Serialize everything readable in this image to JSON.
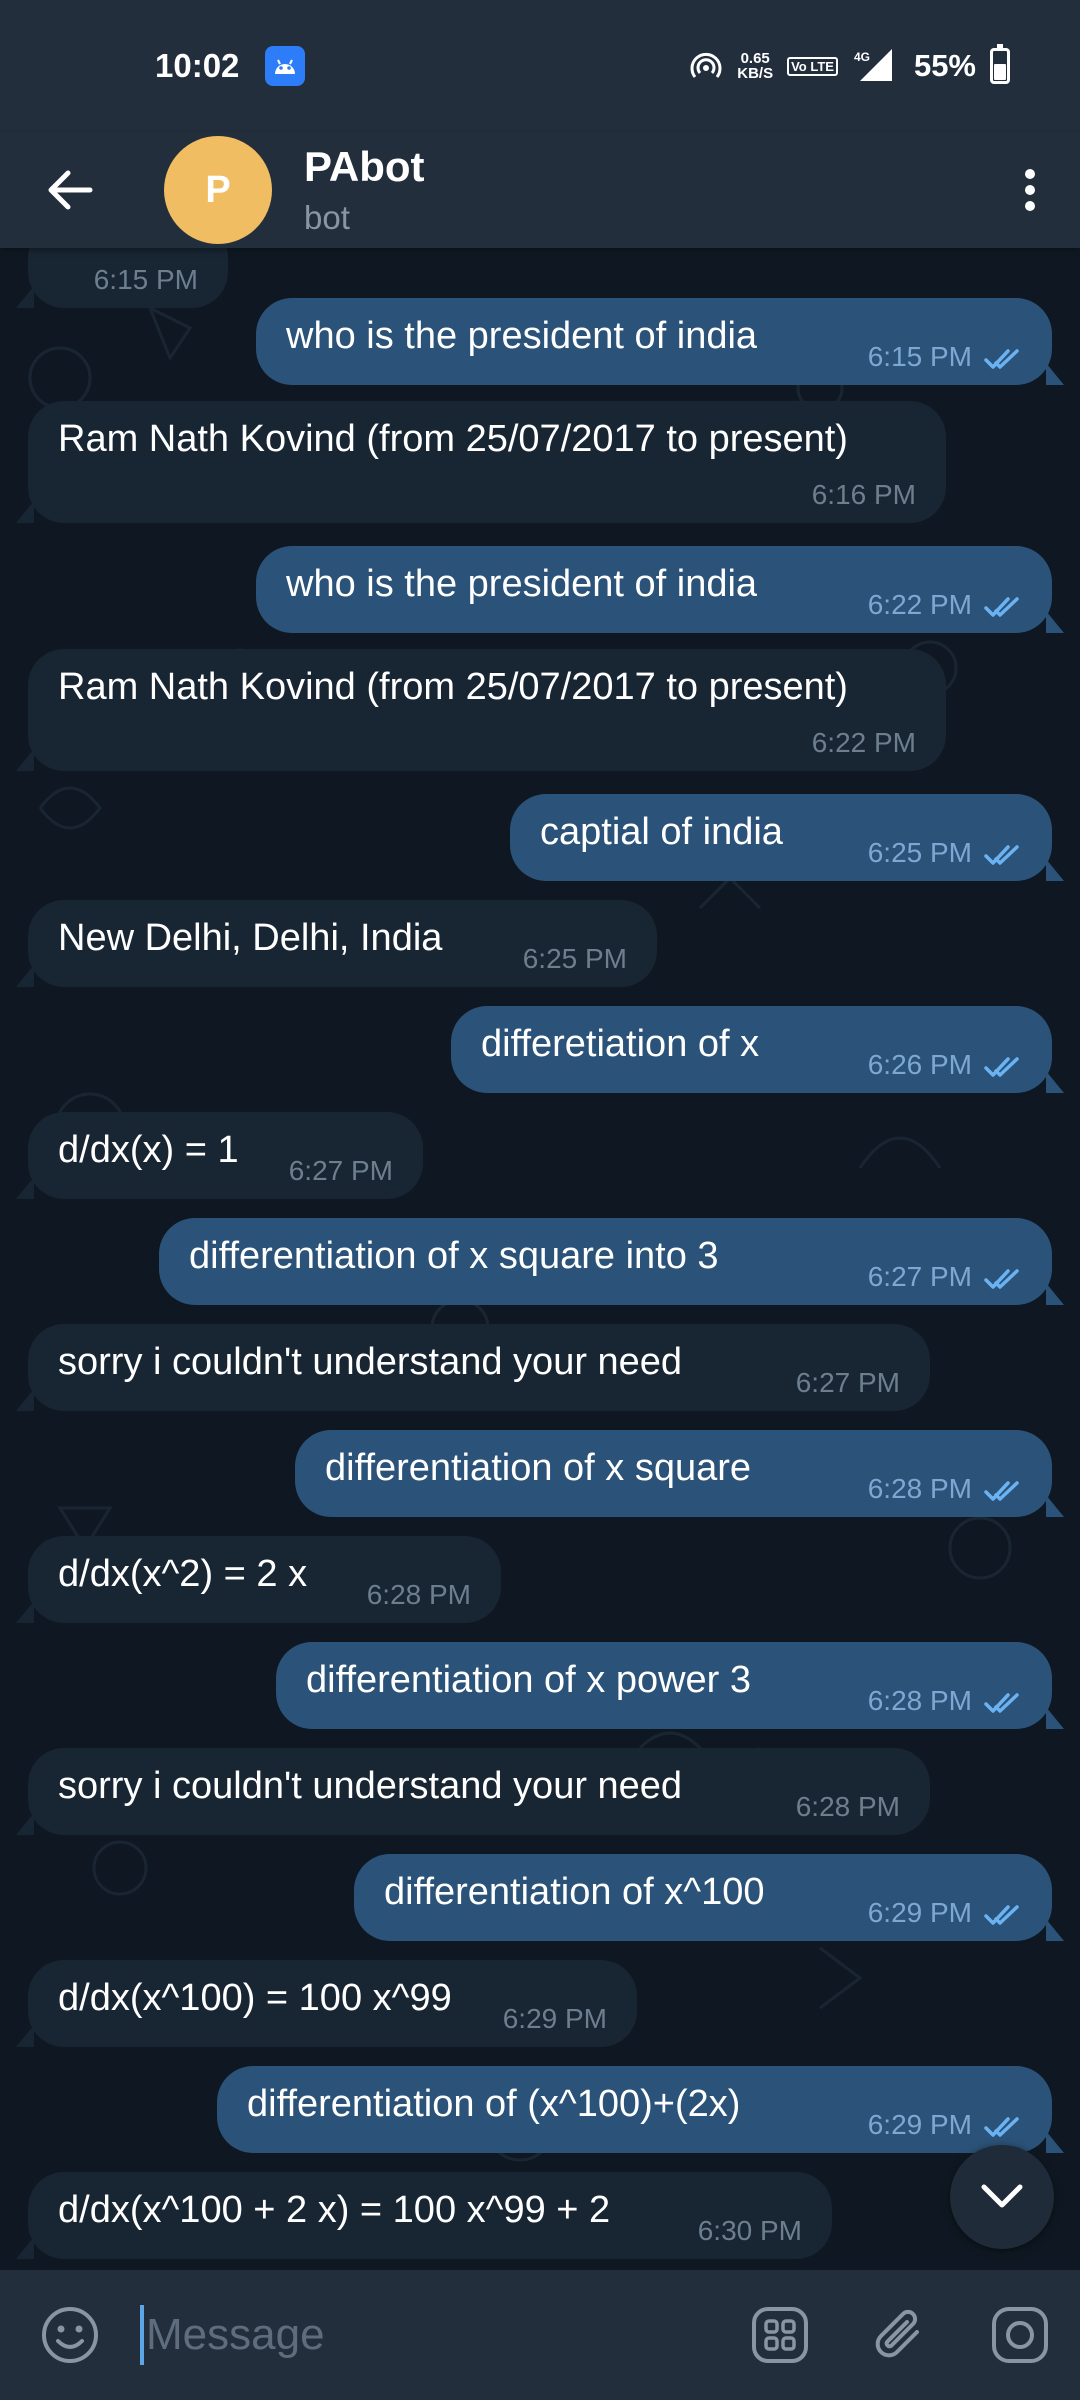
{
  "status_bar": {
    "time": "10:02",
    "net_speed_value": "0.65",
    "net_speed_unit": "KB/S",
    "volte": "Vo LTE",
    "network": "4G",
    "battery_pct": "55%",
    "battery_level": 0.55
  },
  "header": {
    "avatar_letter": "P",
    "title": "PAbot",
    "subtitle": "bot",
    "avatar_color": "#f1bd63"
  },
  "messages": [
    {
      "dir": "in",
      "text": "",
      "time": "6:15 PM"
    },
    {
      "dir": "out",
      "text": "who is the president of india",
      "time": "6:15 PM"
    },
    {
      "dir": "in",
      "text": "Ram Nath Kovind (from 25/07/2017 to present)",
      "time": "6:16 PM"
    },
    {
      "dir": "out",
      "text": "who is the president of india",
      "time": "6:22 PM"
    },
    {
      "dir": "in",
      "text": "Ram Nath Kovind (from 25/07/2017 to present)",
      "time": "6:22 PM"
    },
    {
      "dir": "out",
      "text": "captial of india",
      "time": "6:25 PM"
    },
    {
      "dir": "in",
      "text": "New Delhi, Delhi, India",
      "time": "6:25 PM"
    },
    {
      "dir": "out",
      "text": "differetiation of x",
      "time": "6:26 PM"
    },
    {
      "dir": "in",
      "text": "d/dx(x) = 1",
      "time": "6:27 PM"
    },
    {
      "dir": "out",
      "text": "differentiation of x square into 3",
      "time": "6:27 PM"
    },
    {
      "dir": "in",
      "text": "sorry i couldn't understand your need",
      "time": "6:27 PM"
    },
    {
      "dir": "out",
      "text": "differentiation of x square",
      "time": "6:28 PM"
    },
    {
      "dir": "in",
      "text": "d/dx(x^2) = 2 x",
      "time": "6:28 PM"
    },
    {
      "dir": "out",
      "text": "differentiation of x power 3",
      "time": "6:28 PM"
    },
    {
      "dir": "in",
      "text": "sorry i couldn't understand your need",
      "time": "6:28 PM"
    },
    {
      "dir": "out",
      "text": "differentiation of x^100",
      "time": "6:29 PM"
    },
    {
      "dir": "in",
      "text": "d/dx(x^100) = 100 x^99",
      "time": "6:29 PM"
    },
    {
      "dir": "out",
      "text": "differentiation of (x^100)+(2x)",
      "time": "6:29 PM"
    },
    {
      "dir": "in",
      "text": "d/dx(x^100 + 2 x) = 100 x^99 + 2",
      "time": "6:30 PM"
    }
  ],
  "input": {
    "placeholder": "Message",
    "value": ""
  },
  "colors": {
    "header_bg": "#232e3c",
    "chat_bg": "#0f1822",
    "incoming_bubble": "#182533",
    "outgoing_bubble": "#2b5278",
    "read_check": "#6ab2f2"
  },
  "icons": {
    "back": "arrow-left-icon",
    "menu": "more-vertical-icon",
    "scroll_down": "chevron-down-icon",
    "emoji": "smile-icon",
    "bot_commands": "grid-icon",
    "attach": "paperclip-icon",
    "camera": "camera-icon",
    "read": "double-check-icon"
  }
}
